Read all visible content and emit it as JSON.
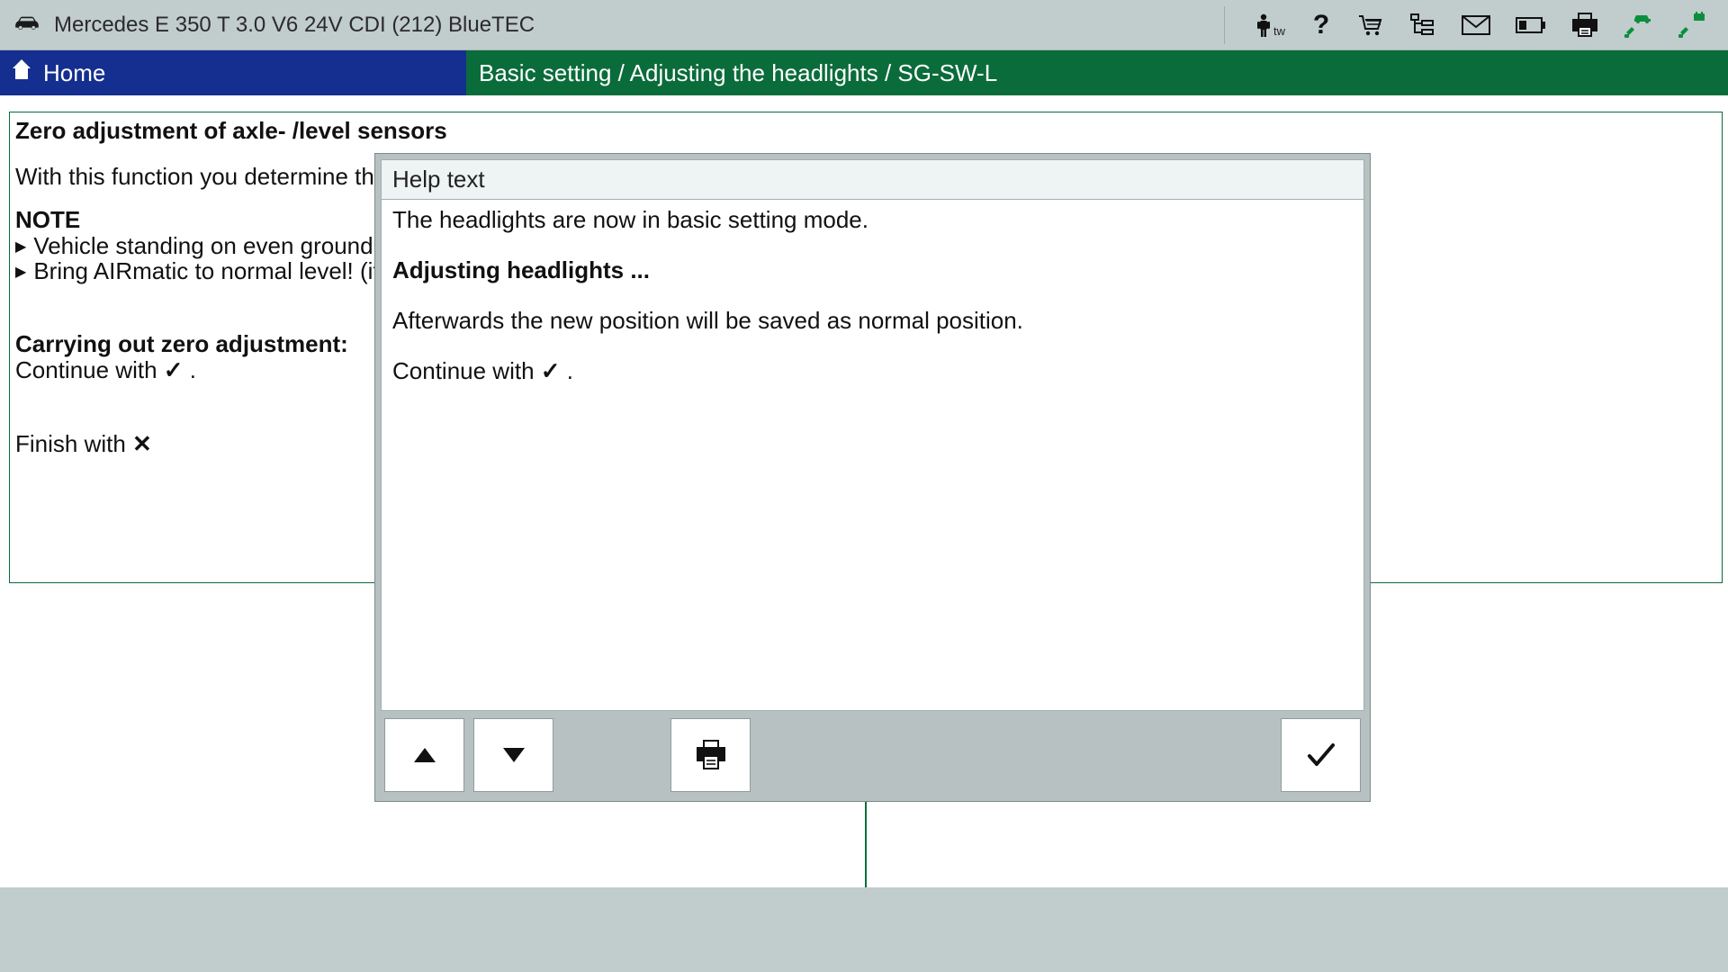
{
  "titlebar": {
    "vehicle": "Mercedes E 350 T 3.0 V6 24V CDI (212) BlueTEC",
    "tw": "tw"
  },
  "header": {
    "home": "Home",
    "breadcrumb": "Basic setting / Adjusting the headlights / SG-SW-L"
  },
  "content": {
    "heading": "Zero adjustment of axle- /level sensors",
    "intro": "With this function you determine the b",
    "note_label": "NOTE",
    "bullet1": "Vehicle standing on even ground and",
    "bullet2": "Bring AIRmatic to normal level! (if in",
    "subheading": "Carrying out zero adjustment:",
    "continue_prefix": "Continue with ",
    "continue_suffix": ".",
    "finish_prefix": "Finish with ",
    "check_glyph": "✓",
    "x_glyph": "✕"
  },
  "help": {
    "title": "Help text",
    "line1": "The headlights are now in basic setting mode.",
    "line2": "Adjusting headlights ...",
    "line3": "Afterwards the new position will be saved as normal position.",
    "line4_prefix": "Continue with ",
    "line4_suffix": ".",
    "check_glyph": "✓"
  }
}
